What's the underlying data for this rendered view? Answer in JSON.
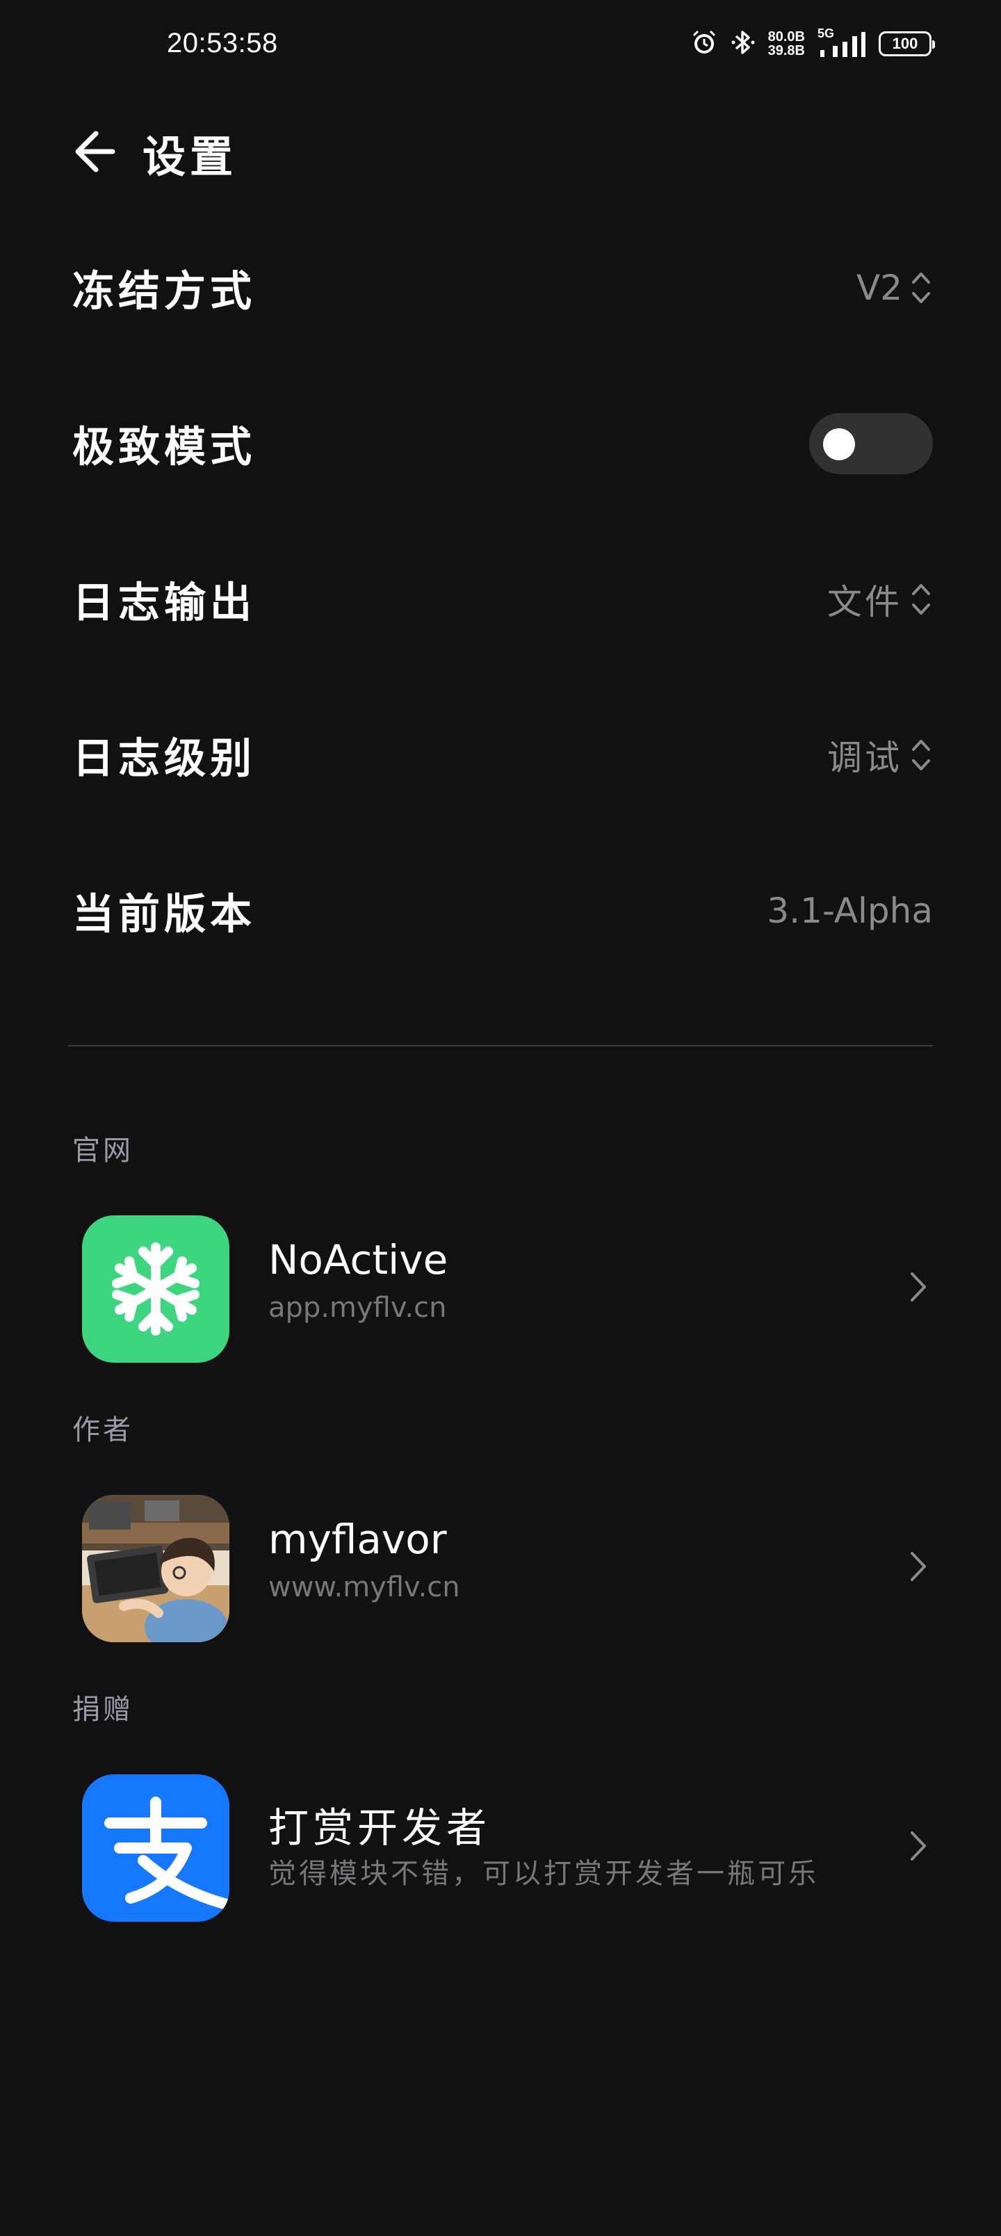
{
  "status_bar": {
    "time": "20:53:58",
    "net_up": "80.0B",
    "net_down": "39.8B",
    "network": "5G",
    "battery": "100",
    "icons": [
      "alarm-icon",
      "bluetooth-icon",
      "signal-icon",
      "battery-icon"
    ]
  },
  "header": {
    "back_icon": "arrow-left-icon",
    "title": "设置"
  },
  "settings": [
    {
      "label": "冻结方式",
      "value": "V2",
      "control": "dropdown"
    },
    {
      "label": "极致模式",
      "control": "toggle",
      "checked": false
    },
    {
      "label": "日志输出",
      "value": "文件",
      "control": "dropdown"
    },
    {
      "label": "日志级别",
      "value": "调试",
      "control": "dropdown"
    },
    {
      "label": "当前版本",
      "value": "3.1-Alpha",
      "control": "text"
    }
  ],
  "sections": [
    {
      "label": "官网",
      "item": {
        "title": "NoActive",
        "subtitle": "app.myflv.cn",
        "icon": "snowflake-icon",
        "icon_color": "#3dd580"
      }
    },
    {
      "label": "作者",
      "item": {
        "title": "myflavor",
        "subtitle": "www.myflv.cn",
        "icon": "avatar-icon"
      }
    },
    {
      "label": "捐赠",
      "item": {
        "title": "打赏开发者",
        "subtitle": "觉得模块不错，可以打赏开发者一瓶可乐",
        "icon": "alipay-icon",
        "icon_color": "#1677ff"
      }
    }
  ],
  "colors": {
    "background": "#111112",
    "secondary_text": "#8a8a8a",
    "toggle_track": "#323234"
  }
}
